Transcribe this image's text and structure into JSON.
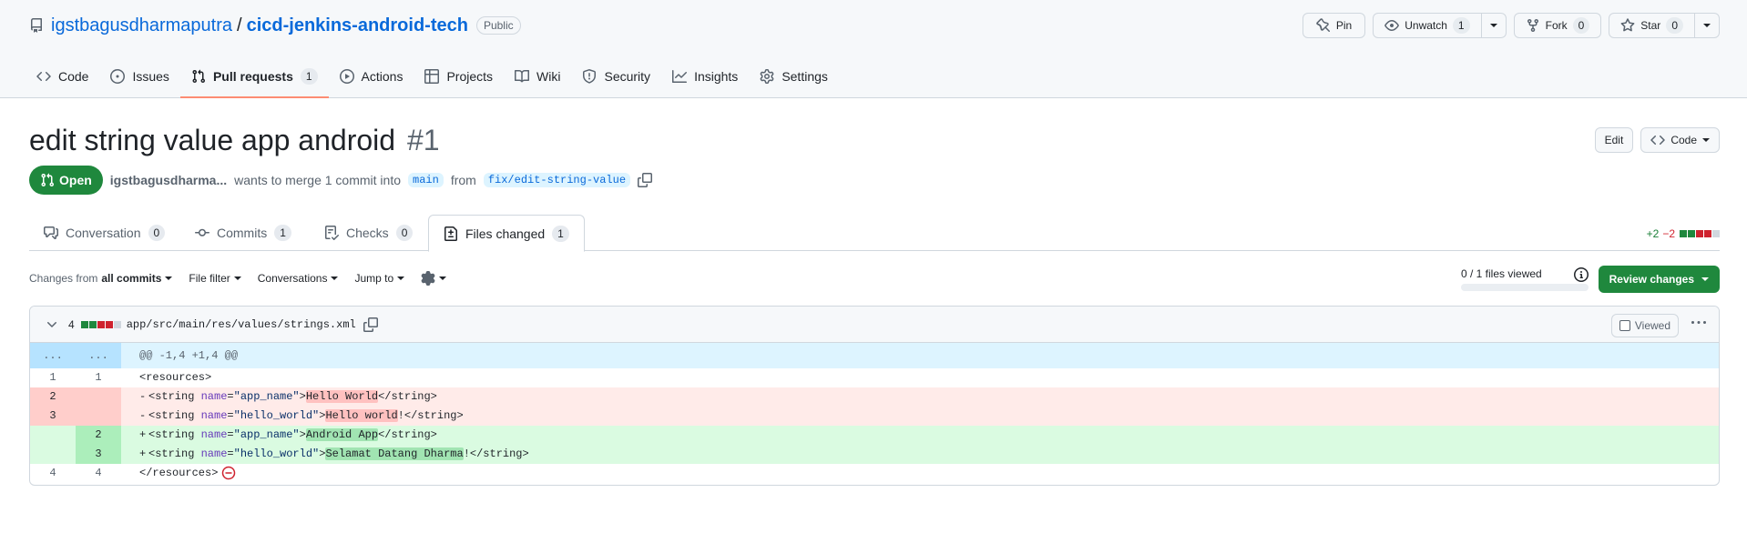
{
  "repo": {
    "owner": "igstbagusdharmaputra",
    "separator": "/",
    "name": "cicd-jenkins-android-tech",
    "visibility": "Public"
  },
  "header_actions": {
    "pin": "Pin",
    "unwatch": "Unwatch",
    "unwatch_count": "1",
    "fork": "Fork",
    "fork_count": "0",
    "star": "Star",
    "star_count": "0"
  },
  "nav": [
    {
      "label": "Code",
      "icon": "code-icon"
    },
    {
      "label": "Issues",
      "icon": "issue-opened-icon"
    },
    {
      "label": "Pull requests",
      "icon": "git-pull-request-icon",
      "count": "1",
      "active": true
    },
    {
      "label": "Actions",
      "icon": "play-icon"
    },
    {
      "label": "Projects",
      "icon": "table-icon"
    },
    {
      "label": "Wiki",
      "icon": "book-icon"
    },
    {
      "label": "Security",
      "icon": "shield-icon"
    },
    {
      "label": "Insights",
      "icon": "graph-icon"
    },
    {
      "label": "Settings",
      "icon": "gear-icon"
    }
  ],
  "pr": {
    "title": "edit string value app android",
    "number": "#1",
    "edit_label": "Edit",
    "code_label": "Code",
    "state": "Open",
    "author": "igstbagusdharma...",
    "merge_text": "wants to merge 1 commit into",
    "base_branch": "main",
    "from_text": "from",
    "head_branch": "fix/edit-string-value"
  },
  "tabs": [
    {
      "label": "Conversation",
      "count": "0",
      "icon": "comment-discussion-icon"
    },
    {
      "label": "Commits",
      "count": "1",
      "icon": "git-commit-icon"
    },
    {
      "label": "Checks",
      "count": "0",
      "icon": "checklist-icon"
    },
    {
      "label": "Files changed",
      "count": "1",
      "icon": "file-diff-icon",
      "active": true
    }
  ],
  "diffstat": {
    "additions": "+2",
    "deletions": "−2",
    "blocks": [
      "green",
      "green",
      "red",
      "red",
      "gray"
    ]
  },
  "toolbar": {
    "changes_from_prefix": "Changes from",
    "changes_from_value": "all commits",
    "file_filter": "File filter",
    "conversations": "Conversations",
    "jump_to": "Jump to",
    "files_viewed": "0 / 1 files viewed",
    "files_viewed_fraction": 0,
    "review_button": "Review changes"
  },
  "file": {
    "lines_changed": "4",
    "blocks": [
      "green",
      "green",
      "red",
      "red",
      "gray"
    ],
    "path": "app/src/main/res/values/strings.xml",
    "viewed_label": "Viewed",
    "hunk_header": "@@ -1,4 +1,4 @@",
    "hunk_left": "...",
    "hunk_right": "..."
  },
  "diff_lines": [
    {
      "type": "ctx",
      "old": "1",
      "new": "1",
      "text": "<resources>"
    },
    {
      "type": "del",
      "old": "2",
      "new": "",
      "marker": "-",
      "tag_open": "<string ",
      "attr": "name",
      "eq": "=",
      "value": "\"app_name\"",
      "gt": ">",
      "content": "Hello World",
      "close": "</string>"
    },
    {
      "type": "del",
      "old": "3",
      "new": "",
      "marker": "-",
      "tag_open": "<string ",
      "attr": "name",
      "eq": "=",
      "value": "\"hello_world\"",
      "gt": ">",
      "content": "Hello world",
      "content_tail": "!",
      "close": "</string>"
    },
    {
      "type": "add",
      "old": "",
      "new": "2",
      "marker": "+",
      "tag_open": "<string ",
      "attr": "name",
      "eq": "=",
      "value": "\"app_name\"",
      "gt": ">",
      "content": "Android App",
      "close": "</string>"
    },
    {
      "type": "add",
      "old": "",
      "new": "3",
      "marker": "+",
      "tag_open": "<string ",
      "attr": "name",
      "eq": "=",
      "value": "\"hello_world\"",
      "gt": ">",
      "content": "Selamat Datang Dharma",
      "content_tail": "!",
      "close": "</string>"
    },
    {
      "type": "ctx",
      "old": "4",
      "new": "4",
      "text": "</resources>",
      "no_eol": true
    }
  ],
  "colors": {
    "accent": "#0969da",
    "open_green": "#1f883d",
    "del_bg": "#ffebe9",
    "add_bg": "#dafbe1",
    "tab_underline": "#fd8c73"
  }
}
